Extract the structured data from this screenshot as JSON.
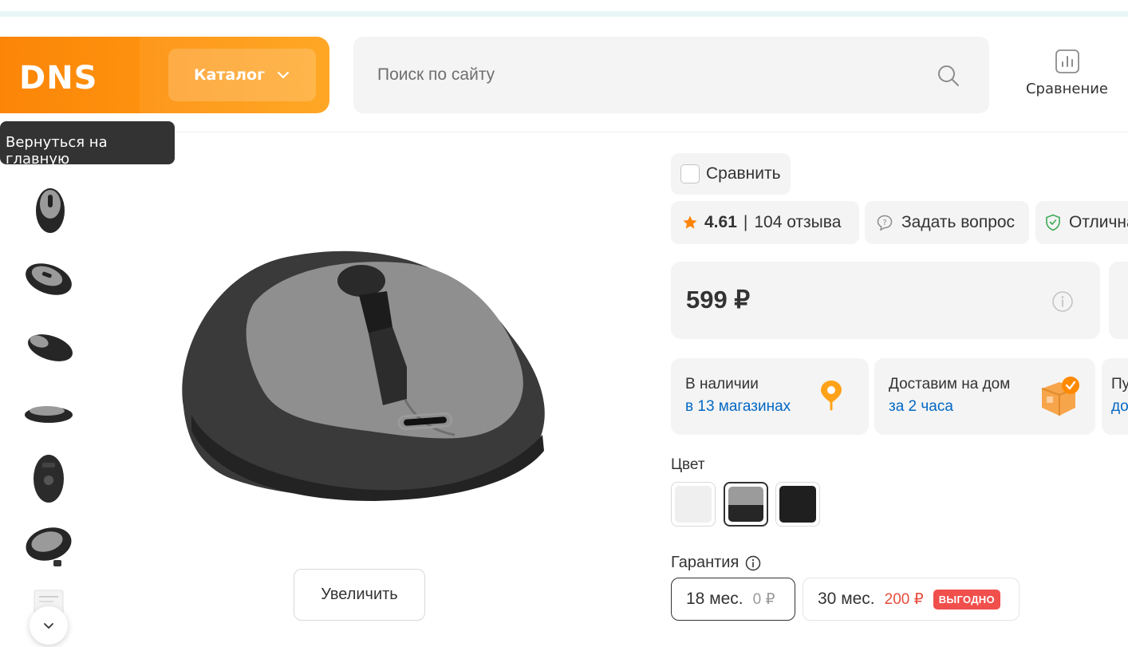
{
  "header": {
    "logo_text": "DNS",
    "catalog_label": "Каталог",
    "search_placeholder": "Поиск по сайту",
    "compare_label": "Сравнение"
  },
  "tooltip": "Вернуться на главную",
  "gallery": {
    "zoom_label": "Увеличить"
  },
  "product": {
    "compare_checkbox_label": "Сравнить",
    "rating": "4.61",
    "rating_sep": "|",
    "reviews": "104 отзыва",
    "ask_label": "Задать вопрос",
    "quality_label": "Отлична",
    "price": "599 ₽",
    "availability": {
      "stores_title": "В наличии",
      "stores_link": "в 13 магазинах",
      "delivery_title": "Доставим на дом",
      "delivery_link": "за 2 часа",
      "pickup_title": "Пу",
      "pickup_link": "до"
    },
    "color_label": "Цвет",
    "colors": [
      "#efefef",
      "gray-black",
      "#1f1f1f"
    ],
    "warranty_label": "Гарантия",
    "warranty_options": [
      {
        "term": "18 мес.",
        "price": "0 ₽"
      },
      {
        "term": "30 мес.",
        "price": "200 ₽",
        "badge": "ВЫГОДНО"
      }
    ]
  },
  "colors": {
    "brand_orange": "#fc8507",
    "link_blue": "#0368c4",
    "badge_red": "#f04f4c",
    "chip_bg": "#f4f4f4"
  }
}
